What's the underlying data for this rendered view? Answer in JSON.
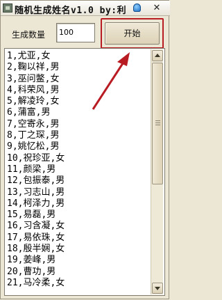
{
  "window": {
    "title": "随机生成姓名v1.0  by:利",
    "close_glyph": "✕"
  },
  "form": {
    "count_label": "生成数量",
    "count_value": "100",
    "start_label": "开始"
  },
  "names": [
    "1,尤亚,女",
    "2,鞠以祥,男",
    "3,巫问鳖,女",
    "4,科荣风,男",
    "5,解凌玲,女",
    "6,蒲富,男",
    "7,空寄永,男",
    "8,丁之琛,男",
    "9,姚忆松,男",
    "10,祝珍亚,女",
    "11,颜梁,男",
    "12,包振泰,男",
    "13,习志山,男",
    "14,柯泽力,男",
    "15,易磊,男",
    "16,习含凝,女",
    "17,易依珠,女",
    "18,殷半娴,女",
    "19,姜峰,男",
    "20,曹功,男",
    "21,马冷柔,女"
  ],
  "annotation": {
    "arrow_color": "#b81c22"
  }
}
